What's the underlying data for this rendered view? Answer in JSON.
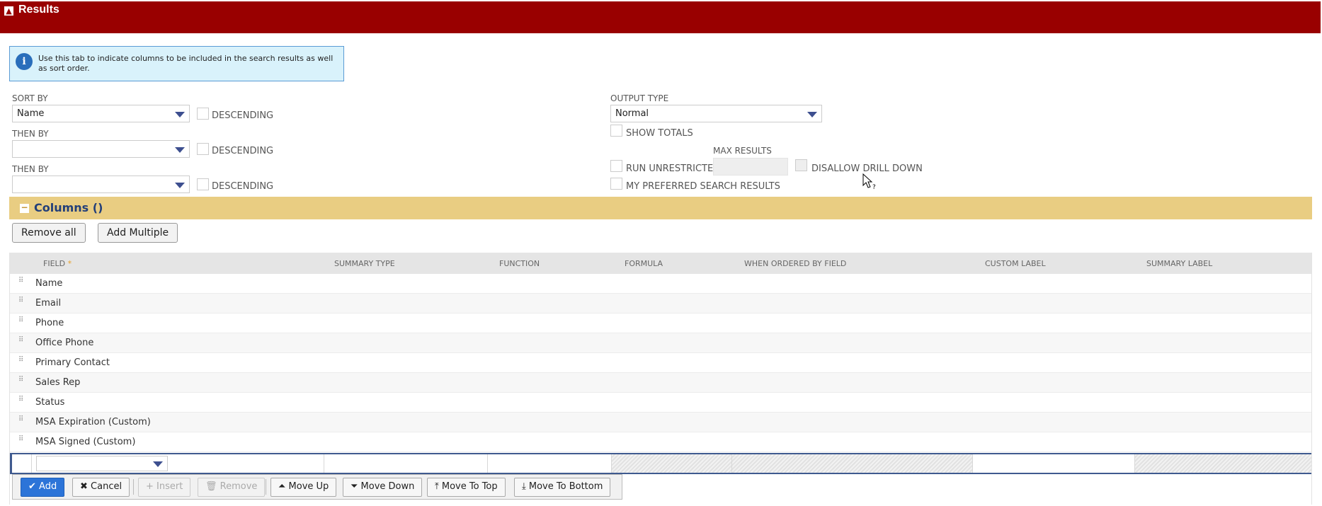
{
  "results": {
    "title": "Results",
    "toggle_icon": "collapse-icon"
  },
  "info": {
    "text": "Use this tab to indicate columns to be included in the search results as well as sort order."
  },
  "sort": {
    "sort_by_label": "SORT BY",
    "sort_by_value": "Name",
    "then_by_label": "THEN BY",
    "then_by_value_1": "",
    "then_by_value_2": "",
    "descending_label": "DESCENDING"
  },
  "output": {
    "output_type_label": "OUTPUT TYPE",
    "output_type_value": "Normal",
    "show_totals": "SHOW TOTALS",
    "run_unrestricted": "RUN UNRESTRICTED",
    "max_results_label": "MAX RESULTS",
    "disallow_drill_down": "DISALLOW DRILL DOWN",
    "my_preferred": "MY PREFERRED SEARCH RESULTS"
  },
  "columns": {
    "title": "Columns ()",
    "remove_all": "Remove all",
    "add_multiple": "Add Multiple",
    "headers": {
      "field": "FIELD",
      "star": "*",
      "summary_type": "SUMMARY TYPE",
      "function": "FUNCTION",
      "formula": "FORMULA",
      "when_ordered": "WHEN ORDERED BY FIELD",
      "custom_label": "CUSTOM LABEL",
      "summary_label": "SUMMARY LABEL"
    },
    "rows": [
      "Name",
      "Email",
      "Phone",
      "Office Phone",
      "Primary Contact",
      "Sales Rep",
      "Status",
      "MSA Expiration (Custom)",
      "MSA Signed (Custom)"
    ]
  },
  "actions": {
    "add": "Add",
    "cancel": "Cancel",
    "insert": "Insert",
    "remove": "Remove",
    "move_up": "Move Up",
    "move_down": "Move Down",
    "move_to_top": "Move To Top",
    "move_to_bottom": "Move To Bottom"
  },
  "colors": {
    "header_red": "#990000",
    "columns_gold": "#e9cd82",
    "primary_blue": "#2c74d8"
  }
}
